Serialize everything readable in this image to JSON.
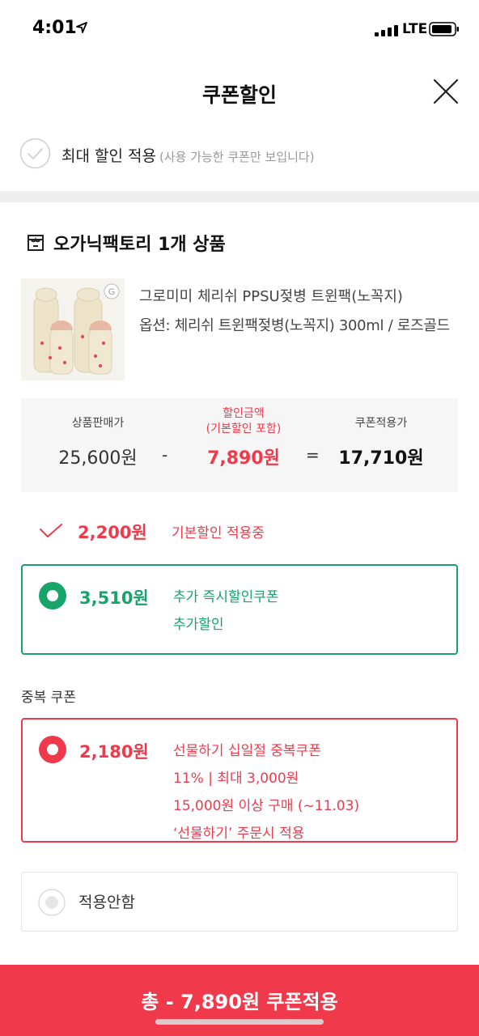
{
  "status_bar": {
    "time": "4:01",
    "network": "LTE"
  },
  "header": {
    "title": "쿠폰할인",
    "close_icon": "close-icon"
  },
  "max_discount": {
    "label": "최대 할인 적용",
    "note": "(사용 가능한 쿠폰만 보입니다)"
  },
  "store": {
    "name": "오가닉팩토리 1개 상품",
    "icon": "store-icon"
  },
  "product": {
    "name": "그로미미 체리쉬 PPSU젖병 트윈팩(노꼭지)",
    "option": "옵션: 체리쉬 트윈팩젖병(노꼭지) 300ml / 로즈골드",
    "image_badge": "G"
  },
  "price_summary": {
    "sale_label": "상품판매가",
    "sale_value": "25,600원",
    "minus": "-",
    "discount_label_line1": "할인금액",
    "discount_label_line2": "(기본할인 포함)",
    "discount_value": "7,890원",
    "equals": "=",
    "coupon_price_label": "쿠폰적용가",
    "coupon_price_value": "17,710원"
  },
  "basic_discount": {
    "amount": "2,200원",
    "text": "기본할인 적용중"
  },
  "instant_coupon": {
    "amount": "3,510원",
    "line1": "추가 즉시할인쿠폰",
    "line2": "추가할인",
    "selected": true
  },
  "duplicate_section": {
    "title": "중복 쿠폰"
  },
  "duplicate_coupon": {
    "amount": "2,180원",
    "line1": "선물하기 십일절 중복쿠폰",
    "line2": "11% | 최대 3,000원",
    "line3": "15,000원 이상 구매 (~11.03)",
    "line4": "‘선물하기’ 주문시 적용",
    "selected": true
  },
  "no_coupon": {
    "label": "적용안함",
    "selected": false
  },
  "bottom_button": {
    "label": "총 - 7,890원 쿠폰적용"
  },
  "colors": {
    "accent_red": "#f03a4b",
    "accent_green": "#18a36a"
  }
}
